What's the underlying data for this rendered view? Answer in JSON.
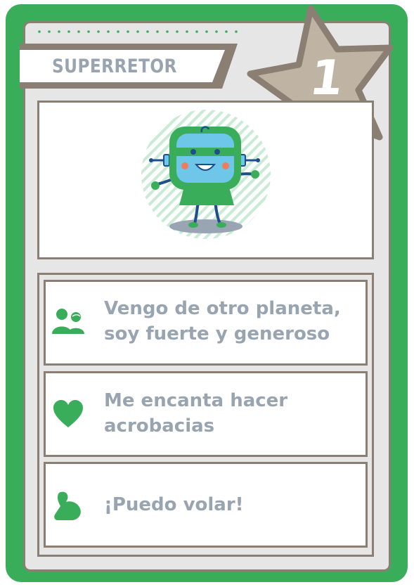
{
  "card": {
    "title": "SUPERRETOR",
    "number": "1"
  },
  "traits": [
    {
      "icon": "people-icon",
      "line1": "Vengo de otro planeta,",
      "line2": "soy fuerte y generoso"
    },
    {
      "icon": "heart-icon",
      "line1": "Me encanta hacer",
      "line2": "acrobacias"
    },
    {
      "icon": "flexed-arm-icon",
      "line1": "¡Puedo volar!",
      "line2": ""
    }
  ],
  "colors": {
    "frame_green": "#3aad5b",
    "panel_border": "#8b7e72",
    "star_fill": "#bfb3a3",
    "text_gray": "#98a4b0",
    "robot_blue": "#6ec6e8"
  }
}
